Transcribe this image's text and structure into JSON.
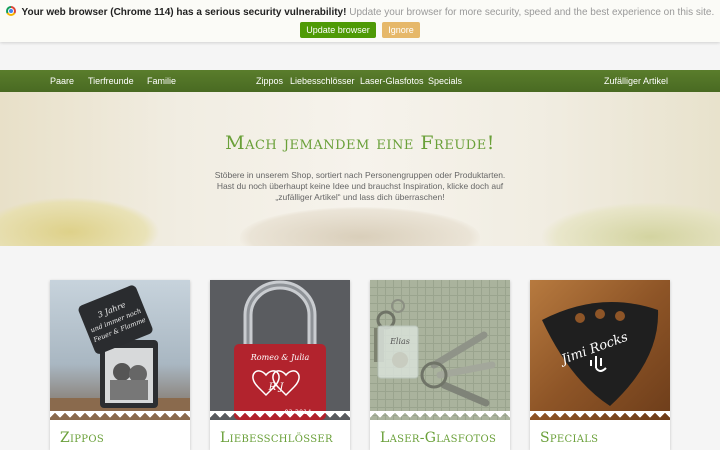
{
  "banner": {
    "warning": "Your web browser (Chrome 114) has a serious security vulnerability!",
    "message": "Update your browser for more security, speed and the best experience on this site.",
    "update_label": "Update browser",
    "ignore_label": "Ignore"
  },
  "nav": {
    "left": [
      "Paare",
      "Tierfreunde",
      "Familie"
    ],
    "center": [
      "Zippos",
      "Liebesschlösser",
      "Laser-Glasfotos",
      "Specials"
    ],
    "right": "Zufälliger Artikel"
  },
  "hero": {
    "title": "Mach jemandem eine Freude!",
    "line1": "Stöbere in unserem Shop, sortiert nach Personengruppen oder Produktarten.",
    "line2": "Hast du noch überhaupt keine Idee und brauchst Inspiration, klicke doch auf",
    "line3": "„zufälliger Artikel“ und lass dich überraschen!"
  },
  "cards": [
    {
      "title": "Zippos",
      "image_text": [
        "3 Jahre",
        "und immer noch",
        "Feuer & Flamme"
      ]
    },
    {
      "title": "Liebesschlösser",
      "image_text": [
        "Romeo & Julia",
        "R J",
        "02.2014"
      ]
    },
    {
      "title": "Laser-Glasfotos",
      "image_text": [
        "Elias"
      ]
    },
    {
      "title": "Specials",
      "image_text": [
        "Jimi Rocks"
      ]
    }
  ],
  "colors": {
    "accent_green": "#6aa039",
    "nav_green": "#496a22",
    "update_button": "#4e9a06",
    "ignore_button": "#e6b86a"
  }
}
